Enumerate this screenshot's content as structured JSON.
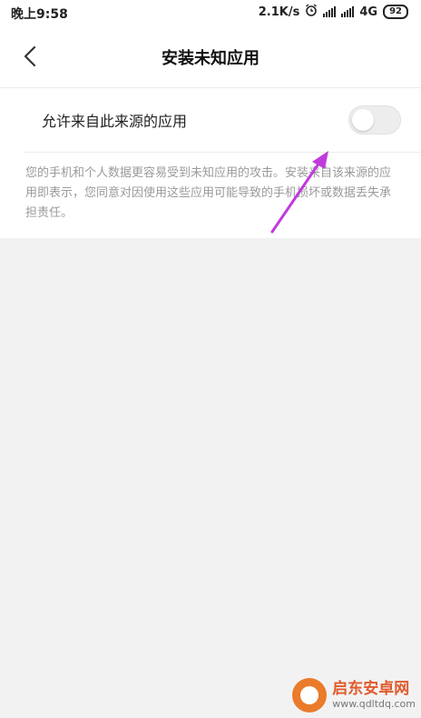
{
  "status_bar": {
    "time": "晚上9:58",
    "speed": "2.1K/s",
    "network": "4G",
    "battery": "92"
  },
  "header": {
    "title": "安装未知应用"
  },
  "setting": {
    "label": "允许来自此来源的应用",
    "enabled": false,
    "description": "您的手机和个人数据更容易受到未知应用的攻击。安装来自该来源的应用即表示，您同意对因使用这些应用可能导致的手机损坏或数据丢失承担责任。"
  },
  "watermark": {
    "name": "启东安卓网",
    "url": "www.qdltdq.com"
  },
  "colors": {
    "arrow": "#c03bdc",
    "watermark_orange": "#e97b2a"
  },
  "icons": {
    "back": "chevron-left-icon",
    "alarm": "alarm-icon",
    "signal": "signal-icon",
    "annotation": "arrow-icon"
  }
}
